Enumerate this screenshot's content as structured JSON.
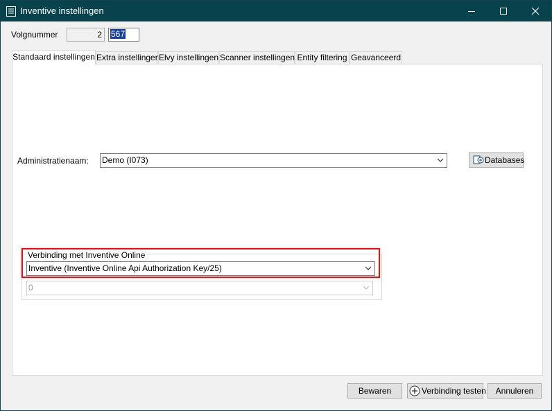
{
  "window": {
    "title": "Inventive instellingen",
    "controls": [
      "minimize-icon",
      "maximize-icon",
      "close-icon"
    ]
  },
  "volgnummer": {
    "label": "Volgnummer",
    "readonly_value": "2",
    "value": "567"
  },
  "tabs": [
    {
      "label": "Standaard instellingen",
      "active": true
    },
    {
      "label": "Extra instellingen",
      "active": false
    },
    {
      "label": "Elvy instellingen",
      "active": false
    },
    {
      "label": "Scanner instellingen",
      "active": false
    },
    {
      "label": "Entity filtering",
      "active": false
    },
    {
      "label": "Geavanceerd",
      "active": false
    }
  ],
  "administratie": {
    "label": "Administratienaam:",
    "selected": "Demo (I073)",
    "databases_button": "Databases"
  },
  "verbinding": {
    "legend": "Verbinding met Inventive Online",
    "selected": "Inventive (Inventive Online Api Authorization Key/25)",
    "secondary_selected": "0"
  },
  "footer": {
    "save": "Bewaren",
    "test": "Verbinding testen",
    "cancel": "Annuleren"
  },
  "colors": {
    "titlebar": "#07424d",
    "highlight_outline": "#e0131b",
    "selection": "#1a3f99"
  }
}
